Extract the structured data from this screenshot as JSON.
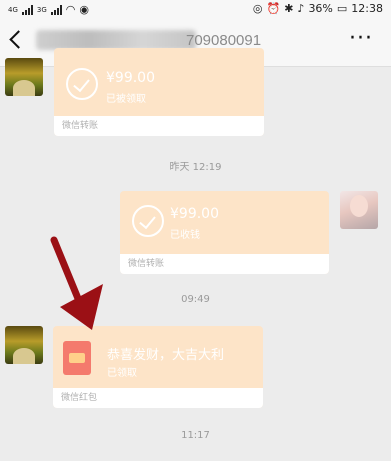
{
  "status": {
    "network_label_1": "4G",
    "network_label_2": "3G",
    "battery": "36%",
    "time": "12:38"
  },
  "header": {
    "title_visible_fragment": "709080091"
  },
  "messages": [
    {
      "type": "transfer",
      "side": "left",
      "amount": "¥99.00",
      "status": "已被领取",
      "footer": "微信转账"
    },
    {
      "type": "timestamp",
      "text": "昨天 12:19"
    },
    {
      "type": "transfer",
      "side": "right",
      "amount": "¥99.00",
      "status": "已收钱",
      "footer": "微信转账"
    },
    {
      "type": "timestamp",
      "text": "09:49"
    },
    {
      "type": "red_packet",
      "side": "left",
      "title": "恭喜发财，大吉大利",
      "status": "已领取",
      "footer": "微信红包"
    },
    {
      "type": "timestamp",
      "text": "11:17"
    }
  ],
  "colors": {
    "card_bg": "#fde4c8",
    "annotation_arrow": "#9b1015"
  }
}
